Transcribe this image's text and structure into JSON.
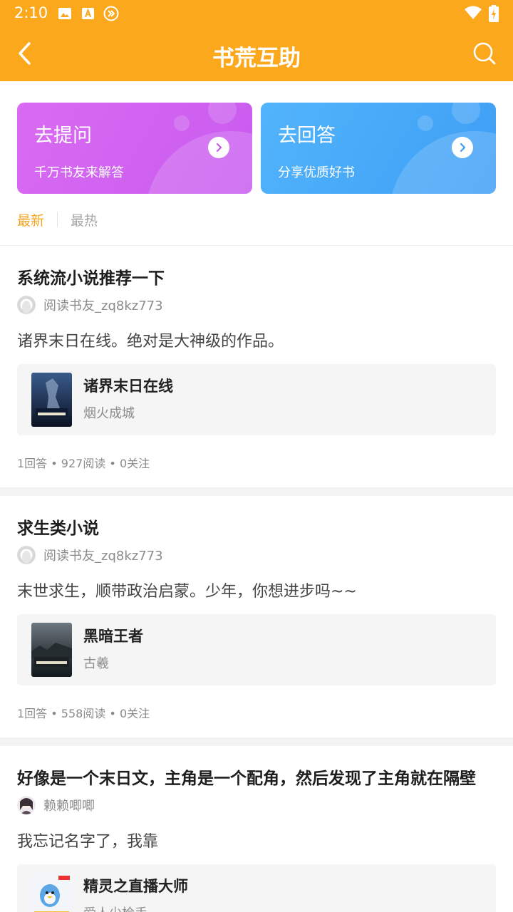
{
  "status_bar": {
    "time": "2:10"
  },
  "header": {
    "title": "书荒互助"
  },
  "cards": {
    "ask": {
      "title": "去提问",
      "subtitle": "千万书友来解答"
    },
    "answer": {
      "title": "去回答",
      "subtitle": "分享优质好书"
    }
  },
  "tabs": [
    {
      "label": "最新",
      "active": true
    },
    {
      "label": "最热",
      "active": false
    }
  ],
  "posts": [
    {
      "title": "系统流小说推荐一下",
      "author": "阅读书友_zq8kz773",
      "content": "诸界末日在线。绝对是大神级的作品。",
      "book": {
        "title": "诸界末日在线",
        "author": "烟火成城"
      },
      "stats": "1回答 • 927阅读 • 0关注"
    },
    {
      "title": "求生类小说",
      "author": "阅读书友_zq8kz773",
      "content": "末世求生，顺带政治启蒙。少年，你想进步吗~~",
      "book": {
        "title": "黑暗王者",
        "author": "古羲"
      },
      "stats": "1回答 • 558阅读 • 0关注"
    },
    {
      "title": "好像是一个末日文，主角是一个配角，然后发现了主角就在隔壁",
      "author": "赖赖唧唧",
      "content": "我忘记名字了，我靠",
      "book": {
        "title": "精灵之直播大师",
        "author": "爱人少检手"
      }
    }
  ],
  "colors": {
    "accent": "#FCA81C",
    "tab_active": "#F5A623",
    "ask_card": "#D96BF2",
    "answer_card": "#4AABF8"
  }
}
